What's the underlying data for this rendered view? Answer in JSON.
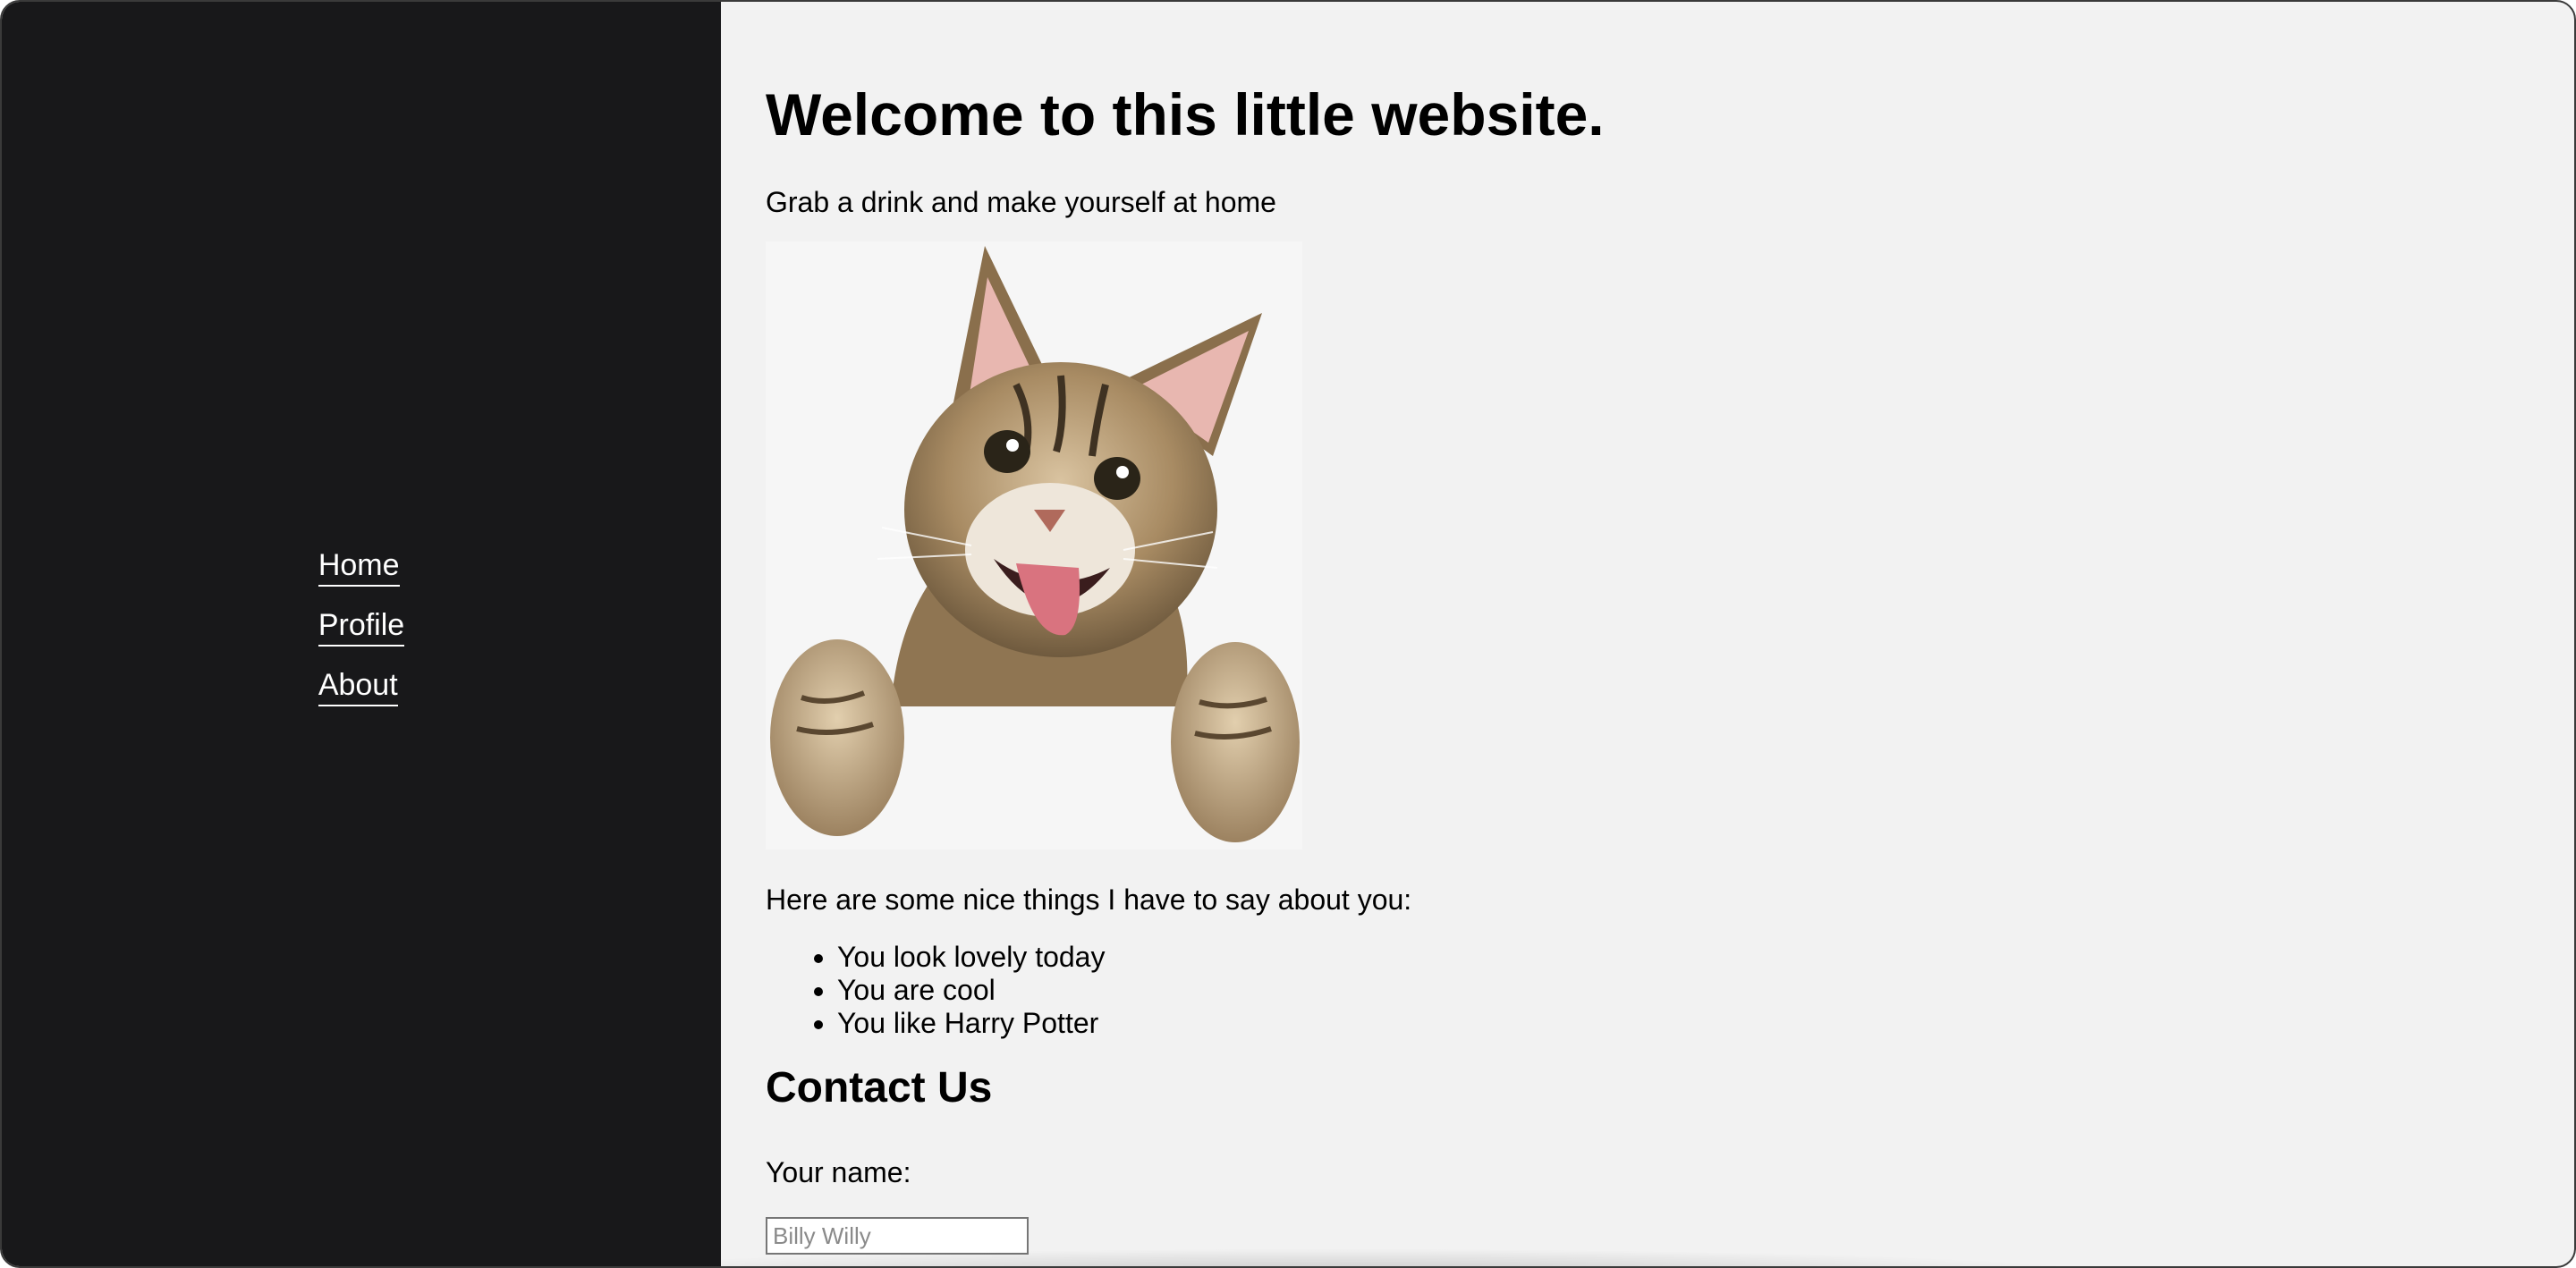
{
  "nav": {
    "items": [
      {
        "label": "Home"
      },
      {
        "label": "Profile"
      },
      {
        "label": "About"
      }
    ]
  },
  "main": {
    "title": "Welcome to this little website.",
    "tagline": "Grab a drink and make yourself at home",
    "image_icon": "cat-photo",
    "nice_intro": "Here are some nice things I have to say about you:",
    "nice_things": [
      "You look lovely today",
      "You are cool",
      "You like Harry Potter"
    ],
    "contact": {
      "heading": "Contact Us",
      "name_label": "Your name:",
      "name_placeholder": "Billy Willy",
      "name_value": ""
    }
  },
  "colors": {
    "sidebar_bg": "#18181a",
    "page_bg": "#f2f2f2",
    "nav_text": "#ffffff"
  }
}
